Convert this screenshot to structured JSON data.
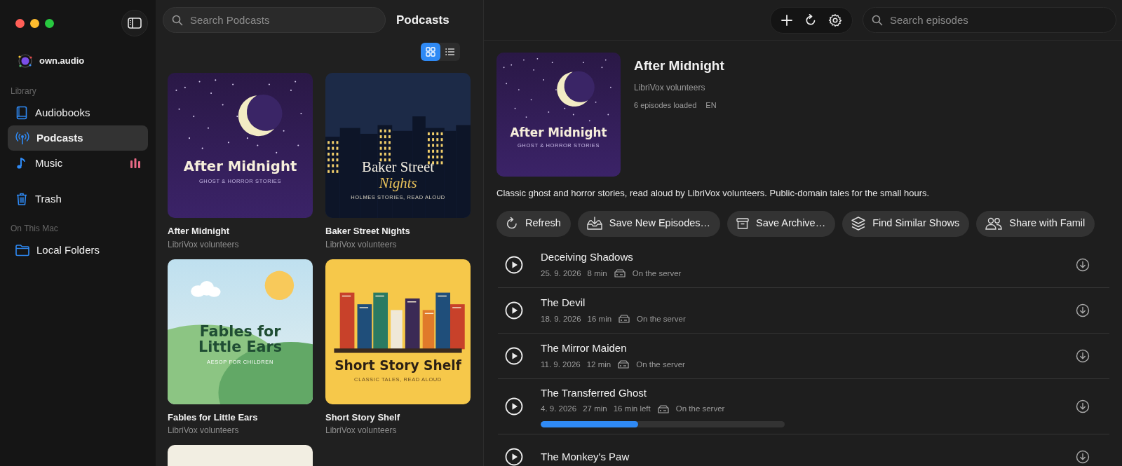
{
  "window": {
    "traffic_lights": [
      {
        "color": "#ff5f57"
      },
      {
        "color": "#febc2e"
      },
      {
        "color": "#28c840"
      }
    ]
  },
  "sidebar": {
    "brand": "own.audio",
    "sections": [
      {
        "label": "Library",
        "items": [
          {
            "label": "Audiobooks",
            "selected": false,
            "playing": false
          },
          {
            "label": "Podcasts",
            "selected": true,
            "playing": false
          },
          {
            "label": "Music",
            "selected": false,
            "playing": true
          }
        ]
      },
      {
        "items": [
          {
            "label": "Trash",
            "selected": false,
            "playing": false
          }
        ]
      },
      {
        "label": "On This Mac",
        "items": [
          {
            "label": "Local Folders",
            "selected": false,
            "playing": false
          }
        ]
      }
    ]
  },
  "library": {
    "search": {
      "placeholder": "Search Podcasts"
    },
    "title": "Podcasts",
    "view_modes": [
      {
        "selected": true
      },
      {
        "selected": false
      }
    ],
    "podcasts": [
      {
        "title": "After Midnight",
        "author": "LibriVox volunteers",
        "cover": {
          "kind": "night",
          "title_lines": [
            "After Midnight"
          ],
          "subtitle": "GHOST & HORROR STORIES"
        }
      },
      {
        "title": "Baker Street Nights",
        "author": "LibriVox volunteers",
        "cover": {
          "kind": "city",
          "title_lines": [
            "Baker Street",
            "Nights"
          ],
          "subtitle": "HOLMES STORIES, READ ALOUD"
        }
      },
      {
        "title": "Fables for Little Ears",
        "author": "LibriVox volunteers",
        "cover": {
          "kind": "meadow",
          "title_lines": [
            "Fables for",
            "Little Ears"
          ],
          "subtitle": "AESOP FOR CHILDREN"
        }
      },
      {
        "title": "Short Story Shelf",
        "author": "LibriVox volunteers",
        "cover": {
          "kind": "shelf",
          "title_lines": [
            "Short Story Shelf"
          ],
          "subtitle": "CLASSIC TALES, READ ALOUD"
        }
      },
      {
        "cover": {
          "kind": "plain"
        }
      }
    ]
  },
  "episodes_pane": {
    "search": {
      "placeholder": "Search episodes"
    },
    "show": {
      "cover": {
        "kind": "night",
        "title_lines": [
          "After Midnight"
        ],
        "subtitle": "GHOST & HORROR STORIES"
      },
      "title": "After Midnight",
      "author": "LibriVox volunteers",
      "meta": [
        "6 episodes loaded",
        "EN"
      ],
      "description": "Classic ghost and horror stories, read aloud by LibriVox volunteers. Public-domain tales for the small hours.",
      "actions": [
        "Refresh",
        "Save New Episodes…",
        "Save Archive…",
        "Find Similar Shows",
        "Share with Famil"
      ]
    },
    "episodes": [
      {
        "title": "Deceiving Shadows",
        "meta": [
          "25. 9. 2026",
          "8 min"
        ],
        "status": "On the server"
      },
      {
        "title": "The Devil",
        "meta": [
          "18. 9. 2026",
          "16 min"
        ],
        "status": "On the server"
      },
      {
        "title": "The Mirror Maiden",
        "meta": [
          "11. 9. 2026",
          "12 min"
        ],
        "status": "On the server"
      },
      {
        "title": "The Transferred Ghost",
        "meta": [
          "4. 9. 2026",
          "27 min",
          "16 min left"
        ],
        "status": "On the server",
        "level": 0.4
      },
      {
        "title": "The Monkey's Paw"
      }
    ]
  }
}
